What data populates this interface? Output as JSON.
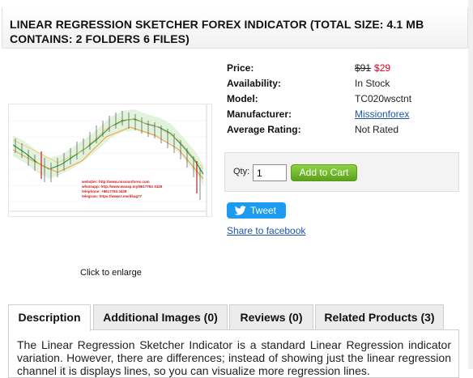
{
  "product": {
    "title": "LINEAR REGRESSION SKETCHER FOREX INDICATOR (TOTAL SIZE: 4.1 MB CONTAINS: 2 FOLDERS 6 FILES)",
    "image_overlay_lines": [
      "webs|ter: http://www.missionforex.com",
      "whatsapp: http://www.wasap.my/8617784 3428",
      "telephone: +8617784 3428",
      "telegram: https://www.t.me/dkag77"
    ],
    "enlarge_text": "Click to enlarge"
  },
  "specs": {
    "price_label": "Price:",
    "old_price": "$91",
    "new_price": "$29",
    "availability_label": "Availability:",
    "availability": "In Stock",
    "model_label": "Model:",
    "model": "TC020wsctnt",
    "manufacturer_label": "Manufacturer:",
    "manufacturer": "Missionforex",
    "rating_label": "Average Rating:",
    "rating": "Not Rated"
  },
  "cart": {
    "qty_label": "Qty:",
    "qty_value": "1",
    "add_label": "Add to Cart"
  },
  "social": {
    "tweet_label": "Tweet",
    "share_label": "Share to facebook"
  },
  "tabs": [
    {
      "label": "Description"
    },
    {
      "label": "Additional Images (0)"
    },
    {
      "label": "Reviews (0)"
    },
    {
      "label": "Related Products (3)"
    }
  ],
  "description": "The Linear Regression Sketcher Indicator is a standard Linear Regression indicator variation. However, there are differences; instead of showing just the linear regression channel it is displays lines, so you can visualize more regression lines.",
  "colors": {
    "price_red": "#e0001b",
    "link_blue": "#1a56b0",
    "cart_green": "#5aa21a",
    "twitter_blue": "#1d9bf0"
  }
}
